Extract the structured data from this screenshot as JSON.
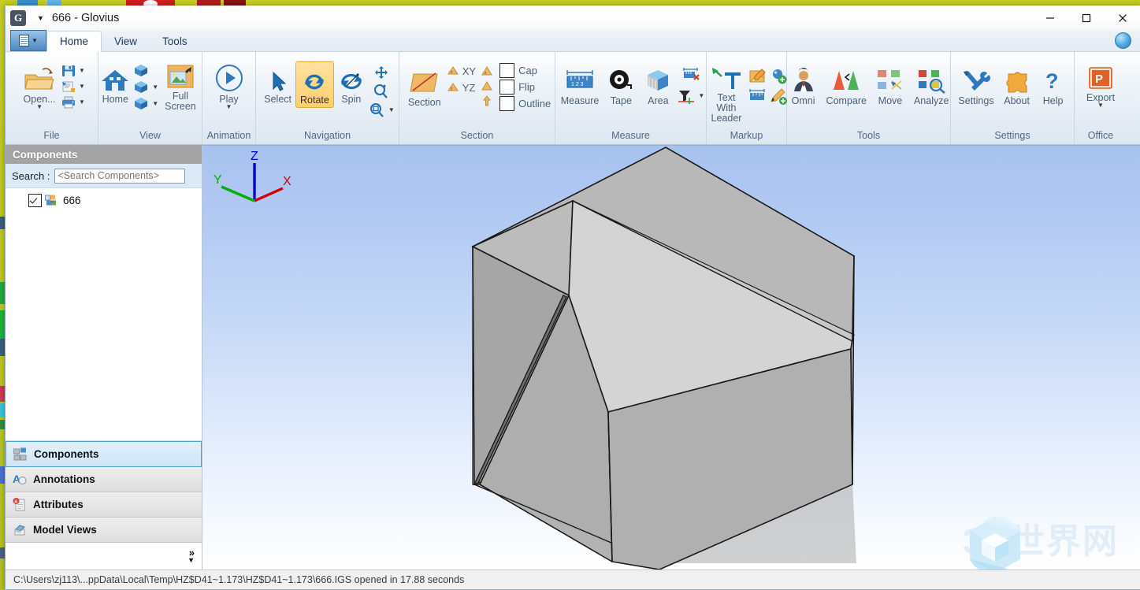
{
  "window": {
    "title": "666 - Glovius",
    "logo_letter": "G",
    "minimize": "─",
    "maximize": "☐",
    "close": "✕"
  },
  "tabs": [
    {
      "label": "Home",
      "active": true
    },
    {
      "label": "View",
      "active": false
    },
    {
      "label": "Tools",
      "active": false
    }
  ],
  "ribbon": {
    "groups": [
      {
        "title": "File",
        "buttons": [
          {
            "label": "Open...",
            "icon": "open-folder-icon",
            "has_caret": true
          },
          {
            "label": "",
            "icon": "save-icon",
            "has_caret": true
          },
          {
            "label": "",
            "icon": "save-as-icon",
            "has_caret": true
          },
          {
            "label": "",
            "icon": "print-icon",
            "has_caret": true
          }
        ]
      },
      {
        "title": "View",
        "buttons": [
          {
            "label": "Home",
            "icon": "home-icon",
            "has_caret": false
          },
          {
            "label": "",
            "icon": "view-cube-top-icon",
            "has_caret": false
          },
          {
            "label": "",
            "icon": "view-cube-mid-icon",
            "has_caret": true
          },
          {
            "label": "",
            "icon": "view-cube-bottom-icon",
            "has_caret": true
          },
          {
            "label": "Full Screen",
            "icon": "full-screen-icon",
            "has_caret": false
          }
        ]
      },
      {
        "title": "Animation",
        "buttons": [
          {
            "label": "Play",
            "icon": "play-icon",
            "has_caret": true
          }
        ]
      },
      {
        "title": "Navigation",
        "buttons": [
          {
            "label": "Select",
            "icon": "cursor-arrow-icon",
            "selected": false
          },
          {
            "label": "Rotate",
            "icon": "rotate-icon",
            "selected": true
          },
          {
            "label": "Spin",
            "icon": "spin-icon",
            "selected": false
          },
          {
            "label": "",
            "icon": "pan-move-icon",
            "selected": false
          },
          {
            "label": "",
            "icon": "zoom-in-icon",
            "selected": false
          },
          {
            "label": "",
            "icon": "zoom-window-icon",
            "selected": false,
            "has_caret": true
          }
        ]
      },
      {
        "title": "Section",
        "buttons": [
          {
            "label": "Section",
            "icon": "section-plane-icon"
          }
        ],
        "planes": [
          {
            "label": "XY",
            "icon": "plane-xy-icon"
          },
          {
            "label": "YZ",
            "icon": "plane-yz-icon"
          },
          {
            "label": "",
            "icon": "plane-zx-icon"
          },
          {
            "label": "",
            "icon": "plane-flip-arrow-icon"
          }
        ],
        "checkboxes": [
          {
            "label": "Cap",
            "checked": false
          },
          {
            "label": "Flip",
            "checked": false
          },
          {
            "label": "Outline",
            "checked": false
          }
        ]
      },
      {
        "title": "Measure",
        "buttons": [
          {
            "label": "Measure",
            "icon": "measure-ruler-icon"
          },
          {
            "label": "Tape",
            "icon": "tape-measure-icon"
          },
          {
            "label": "Area",
            "icon": "area-cube-icon"
          },
          {
            "label": "",
            "icon": "delete-measure-icon"
          },
          {
            "label": "",
            "icon": "filter-measure-icon",
            "has_caret": true
          }
        ]
      },
      {
        "title": "Markup",
        "buttons": [
          {
            "label": "Text With Leader",
            "icon": "text-with-leader-icon"
          },
          {
            "label": "",
            "icon": "note-markup-icon"
          },
          {
            "label": "",
            "icon": "add-point-markup-icon"
          },
          {
            "label": "",
            "icon": "dimension-markup-icon"
          },
          {
            "label": "",
            "icon": "add-pencil-markup-icon"
          }
        ]
      },
      {
        "title": "Tools",
        "buttons": [
          {
            "label": "Omni",
            "icon": "omni-person-icon"
          },
          {
            "label": "Compare",
            "icon": "compare-cones-icon"
          },
          {
            "label": "Move",
            "icon": "move-nodes-icon"
          },
          {
            "label": "Analyze",
            "icon": "analyze-search-icon"
          }
        ]
      },
      {
        "title": "Settings",
        "buttons": [
          {
            "label": "Settings",
            "icon": "tools-wrench-icon"
          },
          {
            "label": "About",
            "icon": "puzzle-piece-icon"
          },
          {
            "label": "Help",
            "icon": "question-mark-icon"
          }
        ]
      },
      {
        "title": "Office",
        "buttons": [
          {
            "label": "Export",
            "icon": "powerpoint-export-icon",
            "has_caret": true
          }
        ]
      }
    ]
  },
  "left_panel": {
    "header": "Components",
    "search_label": "Search :",
    "search_value": "",
    "search_placeholder": "<Search Components>",
    "tree": [
      {
        "label": "666",
        "checked": true,
        "icon": "assembly-icon"
      }
    ],
    "nav_items": [
      {
        "label": "Components",
        "icon": "components-icon",
        "active": true
      },
      {
        "label": "Annotations",
        "icon": "annotations-icon",
        "active": false
      },
      {
        "label": "Attributes",
        "icon": "attributes-icon",
        "active": false
      },
      {
        "label": "Model Views",
        "icon": "model-views-icon",
        "active": false
      }
    ],
    "expander": "»"
  },
  "viewport": {
    "axis_triad": {
      "x_label": "X",
      "y_label": "Y",
      "z_label": "Z",
      "x_color": "#d00000",
      "y_color": "#00b000",
      "z_color": "#0000d8"
    },
    "watermark_text": "3D世界网",
    "model_name": "666",
    "colors": {
      "face_light": "#d6d6d6",
      "face_mid": "#b6b6b6",
      "face_dark": "#a2a2a2",
      "face_darker": "#8c8c8c",
      "edge": "#1a1a1a",
      "shadow": "#a7a7a7"
    }
  },
  "status_bar": {
    "message": "C:\\Users\\zj113\\...ppData\\Local\\Temp\\HZ$D41~1.173\\HZ$D41~1.173\\666.IGS opened in 17.88 seconds"
  }
}
